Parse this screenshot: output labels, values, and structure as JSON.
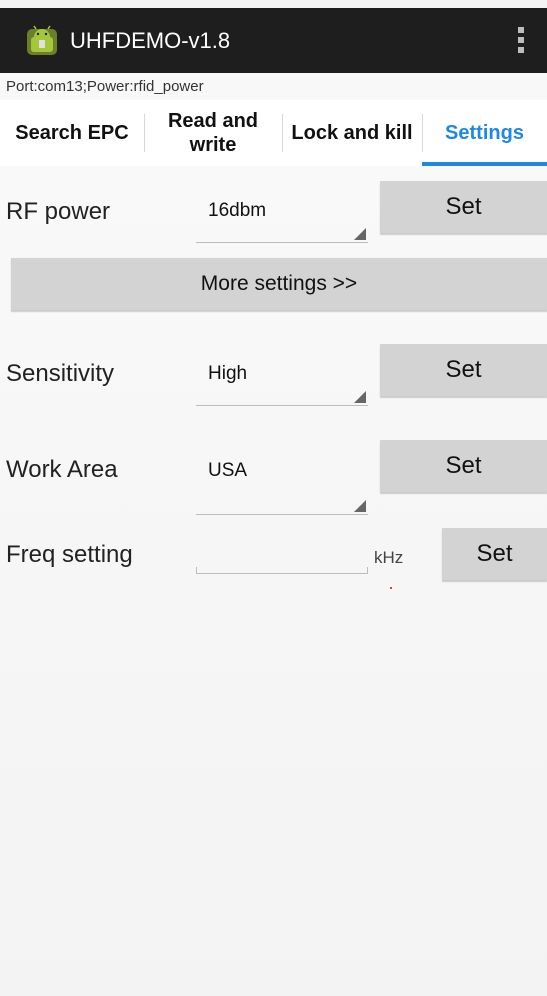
{
  "app": {
    "title": "UHFDEMO-v1.8",
    "icon": "android-icon",
    "overflow_icon": "overflow-menu-icon"
  },
  "status": {
    "text": "Port:com13;Power:rfid_power"
  },
  "tabs": [
    {
      "label": "Search EPC",
      "active": false
    },
    {
      "label": "Read and\nwrite",
      "active": false
    },
    {
      "label": "Lock and kill",
      "active": false
    },
    {
      "label": "Settings",
      "active": true
    }
  ],
  "settings": {
    "rf_power": {
      "label": "RF power",
      "value": "16dbm",
      "button": "Set"
    },
    "more_settings": {
      "label": "More settings >>"
    },
    "sensitivity": {
      "label": "Sensitivity",
      "value": "High",
      "button": "Set"
    },
    "work_area": {
      "label": "Work Area",
      "value": "USA",
      "button": "Set"
    },
    "freq": {
      "label": "Freq setting",
      "value": "",
      "unit": "kHz",
      "button": "Set"
    }
  },
  "colors": {
    "accent": "#1e88e5",
    "action_bar": "#1e1e1e",
    "button": "#d3d3d3"
  }
}
